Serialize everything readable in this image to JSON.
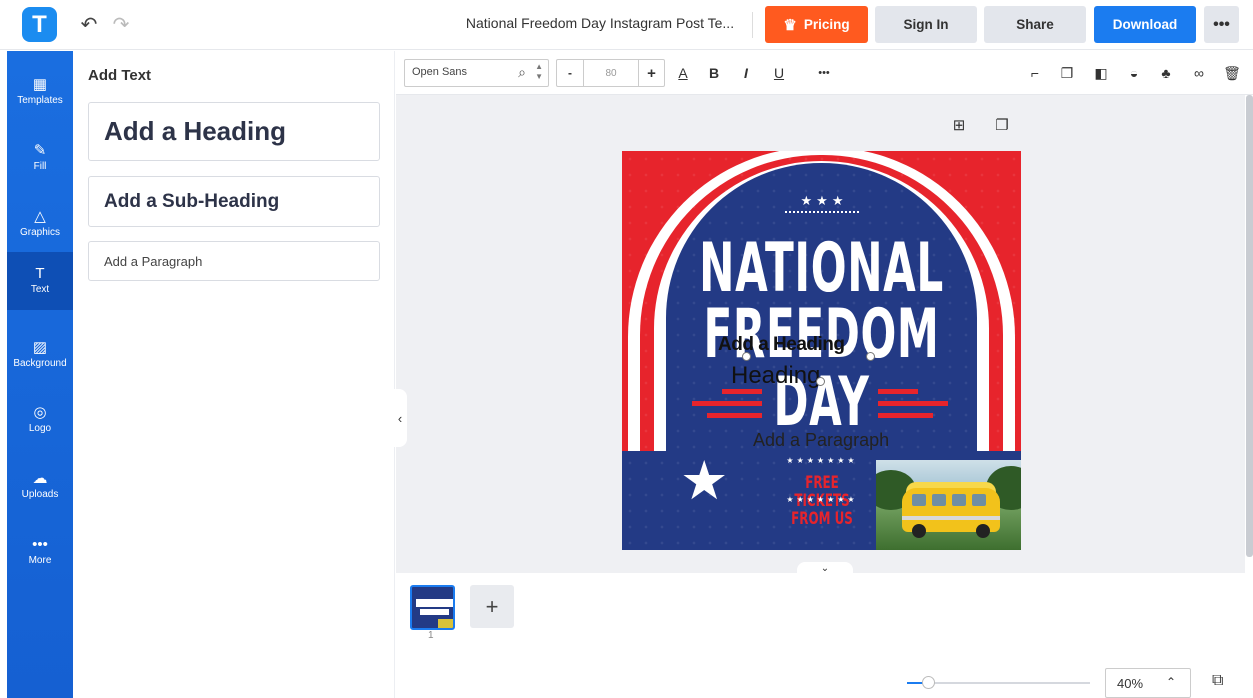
{
  "topbar": {
    "logo_letter": "T",
    "undo": "↶",
    "redo": "↷",
    "document_title": "National Freedom Day Instagram Post Te...",
    "pricing": "Pricing",
    "sign_in": "Sign In",
    "share": "Share",
    "download": "Download",
    "more": "•••"
  },
  "sidebar": {
    "items": [
      {
        "label": "Templates",
        "icon": "templates-icon",
        "glyph": "▦"
      },
      {
        "label": "Fill",
        "icon": "fill-icon",
        "glyph": "✎"
      },
      {
        "label": "Graphics",
        "icon": "graphics-icon",
        "glyph": "△"
      },
      {
        "label": "Text",
        "icon": "text-icon",
        "glyph": "T"
      },
      {
        "label": "Background",
        "icon": "background-icon",
        "glyph": "▨"
      },
      {
        "label": "Logo",
        "icon": "logo-icon",
        "glyph": "◎"
      },
      {
        "label": "Uploads",
        "icon": "upload-icon",
        "glyph": "☁"
      },
      {
        "label": "More",
        "icon": "more-icon",
        "glyph": "•••"
      }
    ],
    "active": "Text"
  },
  "panel": {
    "title": "Add Text",
    "heading": "Add a Heading",
    "subheading": "Add a Sub-Heading",
    "paragraph": "Add a Paragraph"
  },
  "format_toolbar": {
    "font": "Open Sans",
    "size_minus": "-",
    "font_size": "80",
    "size_plus": "+",
    "text_color": "A",
    "bold": "B",
    "italic": "I",
    "underline": "U",
    "more": "•••"
  },
  "poster": {
    "stars_top": "★★★",
    "line1": "NATIONAL",
    "line2": "FREEDOM",
    "line3": "DAY",
    "free_tickets": "FREE TICKETS FROM US",
    "stars_row": "★★★★★★★",
    "overlay_heading": "Add a Heading",
    "overlay_heading2": "Heading",
    "overlay_paragraph": "Add a Paragraph",
    "colors": {
      "navy": "#233a85",
      "red": "#e7242c",
      "white": "#ffffff"
    }
  },
  "pages": {
    "current_page": "1",
    "add_page": "+"
  },
  "zoom": {
    "level": "40%",
    "fraction": 0.12
  }
}
